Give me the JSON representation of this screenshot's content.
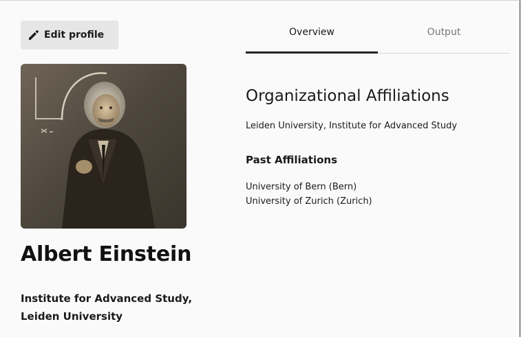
{
  "profile": {
    "edit_label": "Edit profile",
    "name": "Albert Einstein",
    "affiliation_lines": [
      "Institute for Advanced Study,",
      "Leiden University"
    ]
  },
  "tabs": [
    {
      "label": "Overview",
      "active": true
    },
    {
      "label": "Output",
      "active": false
    }
  ],
  "overview": {
    "title": "Organizational Affiliations",
    "current": "Leiden University, Institute for Advanced Study",
    "past_title": "Past Affiliations",
    "past": [
      "University of Bern (Bern)",
      "University of Zurich (Zurich)"
    ]
  },
  "icons": {
    "edit": "pencil-icon"
  },
  "colors": {
    "active_tab_underline": "#222222",
    "button_bg": "#e6e6e6",
    "page_bg": "#fafafa"
  }
}
